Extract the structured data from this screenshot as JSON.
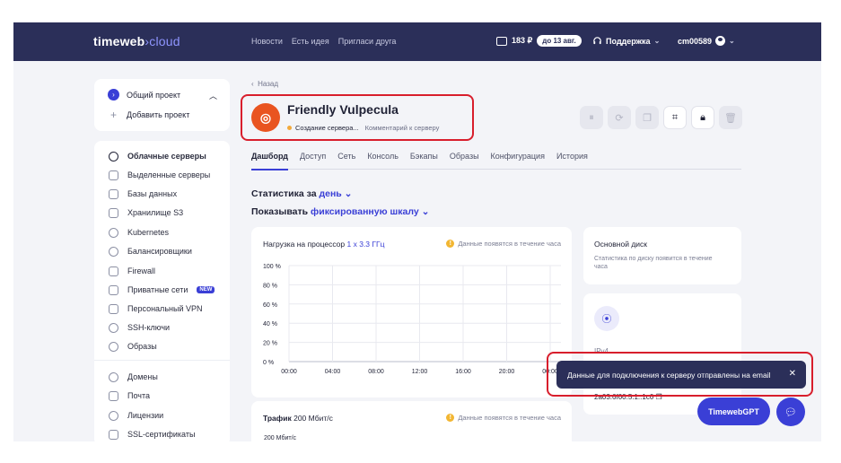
{
  "header": {
    "logo_main": "timeweb",
    "logo_accent": "›cloud",
    "nav": [
      "Новости",
      "Есть идея",
      "Пригласи друга"
    ],
    "balance": "183 ₽",
    "balance_until": "до 13 авг.",
    "support": "Поддержка",
    "user": "cm00589"
  },
  "project": {
    "current": "Общий проект",
    "add": "Добавить проект"
  },
  "sidebar": {
    "items": [
      {
        "label": "Облачные серверы",
        "icon": "cloud-icon"
      },
      {
        "label": "Выделенные серверы",
        "icon": "server-icon"
      },
      {
        "label": "Базы данных",
        "icon": "database-icon"
      },
      {
        "label": "Хранилище S3",
        "icon": "storage-icon"
      },
      {
        "label": "Kubernetes",
        "icon": "kubernetes-icon"
      },
      {
        "label": "Балансировщики",
        "icon": "balancer-icon"
      },
      {
        "label": "Firewall",
        "icon": "firewall-icon"
      },
      {
        "label": "Приватные сети",
        "icon": "network-icon",
        "badge": "NEW"
      },
      {
        "label": "Персональный VPN",
        "icon": "vpn-icon"
      },
      {
        "label": "SSH-ключи",
        "icon": "key-icon"
      },
      {
        "label": "Образы",
        "icon": "image-icon"
      },
      {
        "label": "Домены",
        "icon": "globe-icon"
      },
      {
        "label": "Почта",
        "icon": "mail-icon"
      },
      {
        "label": "Лицензии",
        "icon": "license-icon"
      },
      {
        "label": "SSL-сертификаты",
        "icon": "lock-icon"
      }
    ]
  },
  "server": {
    "back": "Назад",
    "name": "Friendly Vulpecula",
    "status": "Создание сервера...",
    "comment": "Комментарий к серверу"
  },
  "tabs": [
    "Дашборд",
    "Доступ",
    "Сеть",
    "Консоль",
    "Бэкапы",
    "Образы",
    "Конфигурация",
    "История"
  ],
  "stats": {
    "period_prefix": "Статистика за",
    "period": "день",
    "scale_prefix": "Показывать",
    "scale": "фиксированную шкалу"
  },
  "cpu_panel": {
    "title": "Нагрузка на процессор",
    "spec": "1 x 3.3 ГГц",
    "note": "Данные появятся в течение часа"
  },
  "traffic_panel": {
    "title": "Трафик",
    "spec": "200 Мбит/с",
    "note": "Данные появятся в течение часа",
    "first_tick": "200 Мбит/с"
  },
  "disk_panel": {
    "title": "Основной диск",
    "note": "Статистика по диску появится в течение часа"
  },
  "ip_panel": {
    "label": "IPv4",
    "value": "2a03:6f00:5:1::1c0"
  },
  "toast": {
    "message": "Данные для подключения к серверу отправлены на email"
  },
  "assistant": {
    "label": "TimewebGPT"
  },
  "chart_data": {
    "type": "line",
    "title": "Нагрузка на процессор",
    "x": [
      "00:00",
      "04:00",
      "08:00",
      "12:00",
      "16:00",
      "20:00",
      "00:00"
    ],
    "y_ticks": [
      "100 %",
      "80 %",
      "60 %",
      "40 %",
      "20 %",
      "0 %"
    ],
    "ylim": [
      0,
      100
    ],
    "series": [],
    "grid": true
  },
  "colors": {
    "brand": "#2b2f59",
    "accent": "#3a3fd6",
    "ubuntu": "#e95420",
    "status": "#f2a93b",
    "highlight": "#d81e2c"
  }
}
